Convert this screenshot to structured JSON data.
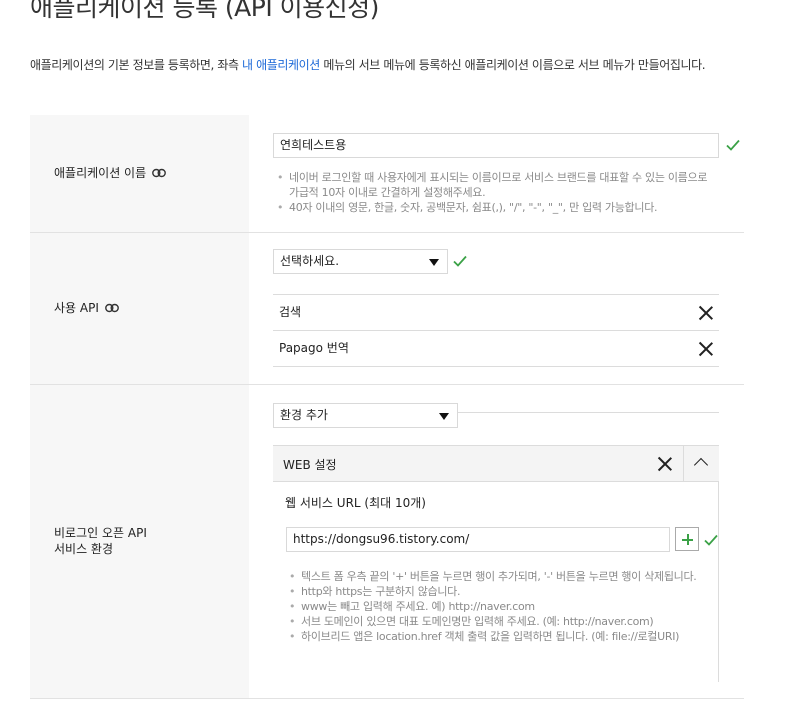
{
  "header": {
    "title": "애플리케이션 등록 (API 이용신청)",
    "intro_before": "애플리케이션의 기본 정보를 등록하면, 좌측 ",
    "intro_link": "내 애플리케이션",
    "intro_after": " 메뉴의 서브 메뉴에 등록하신 애플리케이션 이름으로 서브 메뉴가 만들어집니다."
  },
  "app_name": {
    "label": "애플리케이션 이름",
    "value": "연희테스트용",
    "notes": [
      "네이버 로그인할 때 사용자에게 표시되는 이름이므로 서비스 브랜드를 대표할 수 있는 이름으로 가급적 10자 이내로 간결하게 설정해주세요.",
      "40자 이내의 영문, 한글, 숫자, 공백문자, 쉼표(,), \"/\", \"-\", \"_\", 만 입력 가능합니다."
    ]
  },
  "api": {
    "label": "사용 API",
    "select_value": "선택하세요.",
    "items": [
      "검색",
      "Papago 번역"
    ]
  },
  "env": {
    "label_line1": "비로그인 오픈 API",
    "label_line2": "서비스 환경",
    "select_value": "환경 추가",
    "panel_title": "WEB 설정",
    "url_title": "웹 서비스 URL (최대 10개)",
    "url_value": "https://dongsu96.tistory.com/",
    "notes": [
      "텍스트 폼 우측 끝의 '+' 버튼을 누르면 행이 추가되며, '-' 버튼을 누르면 행이 삭제됩니다.",
      "http와 https는 구분하지 않습니다.",
      "www는 빼고 입력해 주세요. 예) http://naver.com",
      "서브 도메인이 있으면 대표 도메인명만 입력해 주세요. (예: http://naver.com)",
      "하이브리드 앱은 location.href 객체 출력 값을 입력하면 됩니다. (예: file://로컬URI)"
    ]
  },
  "colors": {
    "accent": "#1e6ad8",
    "check": "#3aa146"
  }
}
